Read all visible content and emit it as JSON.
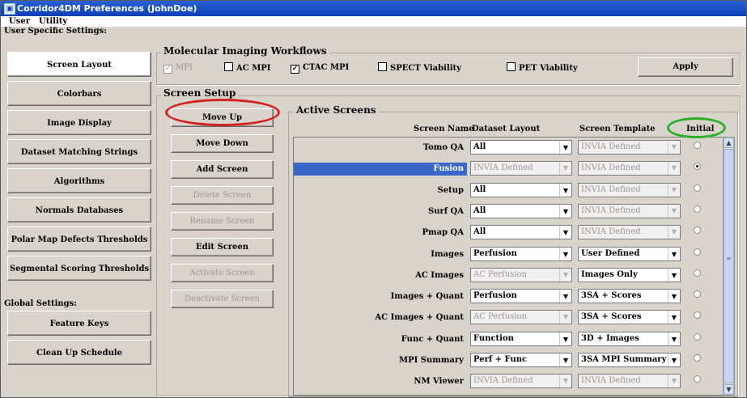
{
  "window": {
    "title": "Corridor4DM Preferences (JohnDoe)",
    "app_icon": "app-icon"
  },
  "menu": [
    "User",
    "Utility"
  ],
  "left": {
    "user_header": "User Specific Settings:",
    "user_items": [
      "Screen Layout",
      "Colorbars",
      "Image Display",
      "Dataset Matching Strings",
      "Algorithms",
      "Normals Databases",
      "Polar Map Defects Thresholds",
      "Segmental Scoring Thresholds"
    ],
    "selected": "Screen Layout",
    "global_header": "Global Settings:",
    "global_items": [
      "Feature Keys",
      "Clean Up Schedule"
    ]
  },
  "workflows": {
    "title": "Molecular Imaging Workflows",
    "items": [
      {
        "label": "MPI",
        "checked": true,
        "disabled": true
      },
      {
        "label": "AC MPI",
        "checked": false,
        "disabled": false
      },
      {
        "label": "CTAC MPI",
        "checked": true,
        "disabled": false
      },
      {
        "label": "SPECT Viability",
        "checked": false,
        "disabled": false
      },
      {
        "label": "PET Viability",
        "checked": false,
        "disabled": false
      }
    ],
    "apply": "Apply"
  },
  "setup": {
    "title": "Screen Setup",
    "buttons": [
      {
        "label": "Move Up",
        "disabled": false
      },
      {
        "label": "Move Down",
        "disabled": false
      },
      {
        "label": "Add Screen",
        "disabled": false
      },
      {
        "label": "Delete Screen",
        "disabled": true
      },
      {
        "label": "Rename Screen",
        "disabled": true
      },
      {
        "label": "Edit Screen",
        "disabled": false
      },
      {
        "label": "Activate Screen",
        "disabled": true
      },
      {
        "label": "Deactivate Screen",
        "disabled": true
      }
    ]
  },
  "active": {
    "title": "Active Screens",
    "headers": {
      "name": "Screen Name",
      "layout": "Dataset Layout",
      "template": "Screen Template",
      "initial": "Initial"
    },
    "rows": [
      {
        "name": "Tomo QA",
        "layout": "All",
        "layout_disabled": false,
        "template": "INVIA Defined",
        "template_disabled": true,
        "initial": false,
        "highlight": false
      },
      {
        "name": "Fusion",
        "layout": "INVIA Defined",
        "layout_disabled": true,
        "template": "INVIA Defined",
        "template_disabled": true,
        "initial": true,
        "highlight": true
      },
      {
        "name": "Setup",
        "layout": "All",
        "layout_disabled": false,
        "template": "INVIA Defined",
        "template_disabled": true,
        "initial": false,
        "highlight": false
      },
      {
        "name": "Surf QA",
        "layout": "All",
        "layout_disabled": false,
        "template": "INVIA Defined",
        "template_disabled": true,
        "initial": false,
        "highlight": false
      },
      {
        "name": "Pmap QA",
        "layout": "All",
        "layout_disabled": false,
        "template": "INVIA Defined",
        "template_disabled": true,
        "initial": false,
        "highlight": false
      },
      {
        "name": "Images",
        "layout": "Perfusion",
        "layout_disabled": false,
        "template": "User Defined",
        "template_disabled": false,
        "initial": false,
        "highlight": false
      },
      {
        "name": "AC Images",
        "layout": "AC Perfusion",
        "layout_disabled": true,
        "template": "Images Only",
        "template_disabled": false,
        "initial": false,
        "highlight": false
      },
      {
        "name": "Images + Quant",
        "layout": "Perfusion",
        "layout_disabled": false,
        "template": "3SA + Scores",
        "template_disabled": false,
        "initial": false,
        "highlight": false
      },
      {
        "name": "AC Images + Quant",
        "layout": "AC Perfusion",
        "layout_disabled": true,
        "template": "3SA + Scores",
        "template_disabled": false,
        "initial": false,
        "highlight": false
      },
      {
        "name": "Func + Quant",
        "layout": "Function",
        "layout_disabled": false,
        "template": "3D + Images",
        "template_disabled": false,
        "initial": false,
        "highlight": false
      },
      {
        "name": "MPI Summary",
        "layout": "Perf + Func",
        "layout_disabled": false,
        "template": "3SA MPI Summary",
        "template_disabled": false,
        "initial": false,
        "highlight": false
      },
      {
        "name": "NM Viewer",
        "layout": "INVIA Defined",
        "layout_disabled": true,
        "template": "INVIA Defined",
        "template_disabled": true,
        "initial": false,
        "highlight": false
      }
    ]
  },
  "annotations": {
    "red_oval_color": "#d42020",
    "green_oval_color": "#28b028"
  }
}
